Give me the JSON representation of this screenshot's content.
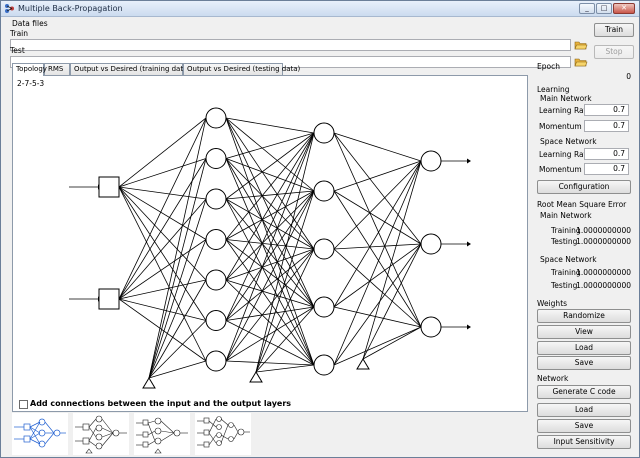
{
  "window": {
    "title": "Multiple Back-Propagation"
  },
  "data_files": {
    "group_label": "Data files",
    "train_label": "Train",
    "test_label": "Test",
    "train_value": "",
    "test_value": ""
  },
  "buttons": {
    "train": "Train",
    "stop": "Stop"
  },
  "tabs": [
    {
      "label": "Topology",
      "active": true
    },
    {
      "label": "RMS",
      "active": false
    },
    {
      "label": "Output vs Desired (training data)",
      "active": false
    },
    {
      "label": "Output vs Desired (testing data)",
      "active": false
    }
  ],
  "topology": {
    "value": "2-7-5-3",
    "input_count": 2,
    "hidden_count": 7,
    "second_count": 5,
    "output_count": 3,
    "checkbox_label": "Add connections between the input and the output layers",
    "checkbox_checked": false
  },
  "epoch": {
    "label": "Epoch",
    "value": "0"
  },
  "learning": {
    "label": "Learning",
    "main_network": {
      "label": "Main Network",
      "learning_rate_label": "Learning Rate",
      "learning_rate": "0.7",
      "momentum_label": "Momentum",
      "momentum": "0.7"
    },
    "space_network": {
      "label": "Space Network",
      "learning_rate_label": "Learning Rate",
      "learning_rate": "0.7",
      "momentum_label": "Momentum",
      "momentum": "0.7"
    },
    "configuration_button": "Configuration"
  },
  "rmse": {
    "label": "Root Mean Square Error",
    "main_network": {
      "label": "Main Network",
      "training_label": "Training",
      "training": "1.0000000000",
      "testing_label": "Testing",
      "testing": "1.0000000000"
    },
    "space_network": {
      "label": "Space Network",
      "training_label": "Training",
      "training": "1.0000000000",
      "testing_label": "Testing",
      "testing": "1.0000000000"
    }
  },
  "weights": {
    "label": "Weights",
    "randomize": "Randomize",
    "view": "View",
    "load": "Load",
    "save": "Save"
  },
  "network": {
    "label": "Network",
    "generate_c_code": "Generate C code",
    "load": "Load",
    "save": "Save",
    "input_sensitivity": "Input Sensitivity"
  },
  "colors": {
    "accent_blue": "#1f5fd1",
    "title_gradient_top": "#e8f0fb",
    "window_bg": "#f0f0f0"
  },
  "icons": {
    "app": "app-icon",
    "folder": "folder-open-icon",
    "minimize": "minimize-icon",
    "maximize": "maximize-icon",
    "close": "close-icon"
  }
}
